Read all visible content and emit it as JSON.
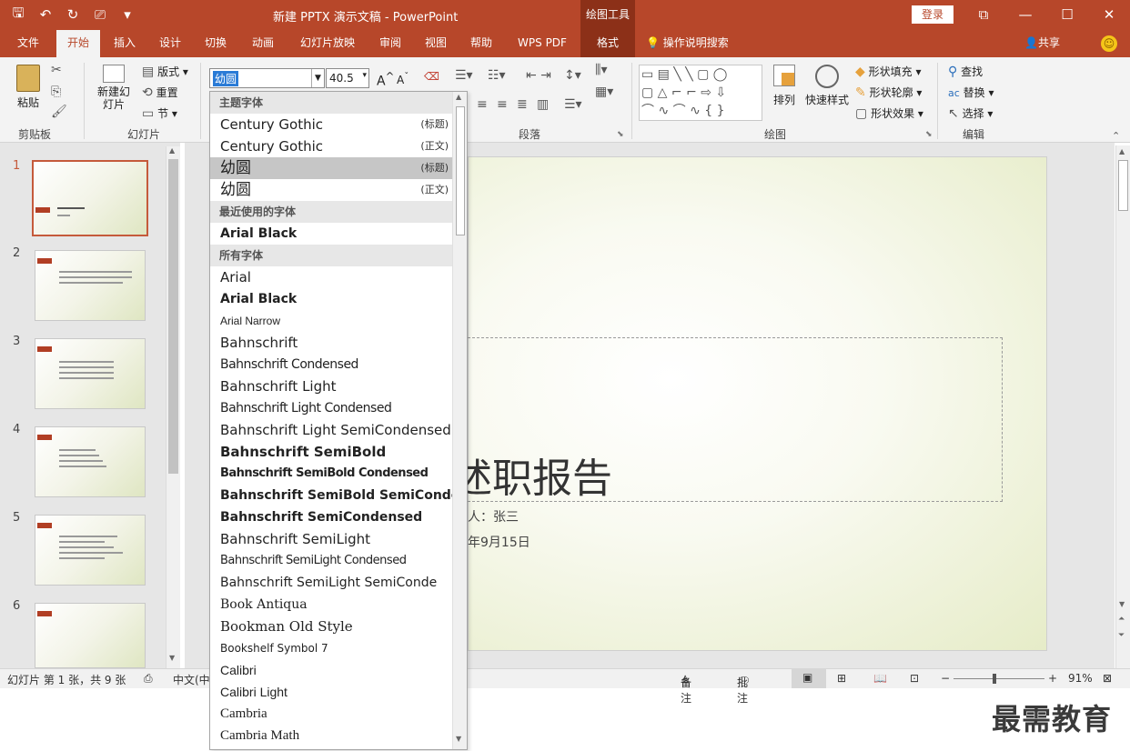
{
  "window": {
    "title": "新建 PPTX 演示文稿 - PowerPoint",
    "context_tab": "绘图工具",
    "login": "登录"
  },
  "tabs": [
    "文件",
    "开始",
    "插入",
    "设计",
    "切换",
    "动画",
    "幻灯片放映",
    "审阅",
    "视图",
    "帮助",
    "WPS PDF",
    "格式"
  ],
  "search_hint": "操作说明搜索",
  "share": "共享",
  "ribbon": {
    "clipboard": {
      "paste": "粘贴",
      "label": "剪贴板"
    },
    "slides": {
      "new_slide": "新建幻灯片",
      "layout": "版式",
      "reset": "重置",
      "section": "节",
      "label": "幻灯片"
    },
    "font": {
      "name": "幼圆",
      "size": "40.5"
    },
    "paragraph": {
      "label": "段落"
    },
    "drawing": {
      "arrange": "排列",
      "quick_styles": "快速样式",
      "fill": "形状填充",
      "outline": "形状轮廓",
      "effects": "形状效果",
      "label": "绘图"
    },
    "editing": {
      "find": "查找",
      "replace": "替换",
      "select": "选择",
      "label": "编辑"
    }
  },
  "font_dropdown": {
    "sections": {
      "theme": "主题字体",
      "recent": "最近使用的字体",
      "all": "所有字体"
    },
    "theme_fonts": [
      {
        "name": "Century Gothic",
        "tag": "(标题)"
      },
      {
        "name": "Century Gothic",
        "tag": "(正文)"
      },
      {
        "name": "幼圆",
        "tag": "(标题)"
      },
      {
        "name": "幼圆",
        "tag": "(正文)"
      }
    ],
    "recent_fonts": [
      "Arial Black"
    ],
    "all_fonts": [
      "Arial",
      "Arial Black",
      "Arial Narrow",
      "Bahnschrift",
      "Bahnschrift Condensed",
      "Bahnschrift Light",
      "Bahnschrift Light Condensed",
      "Bahnschrift Light SemiCondensed",
      "Bahnschrift SemiBold",
      "Bahnschrift SemiBold Condensed",
      "Bahnschrift SemiBold SemiConden",
      "Bahnschrift SemiCondensed",
      "Bahnschrift SemiLight",
      "Bahnschrift SemiLight Condensed",
      "Bahnschrift SemiLight SemiConde",
      "Book Antiqua",
      "Bookman Old Style",
      "Bookshelf Symbol 7",
      "Calibri",
      "Calibri Light",
      "Cambria",
      "Cambria Math"
    ]
  },
  "thumbnails": [
    "1",
    "2",
    "3",
    "4",
    "5",
    "6"
  ],
  "slide": {
    "title": "述职报告",
    "presenter": "人：张三",
    "date": "年9月15日"
  },
  "status": {
    "slide_info": "幻灯片 第 1 张，共 9 张",
    "lang": "中文(中",
    "notes": "备注",
    "comments": "批注",
    "zoom": "91%"
  },
  "watermark": "最需教育"
}
